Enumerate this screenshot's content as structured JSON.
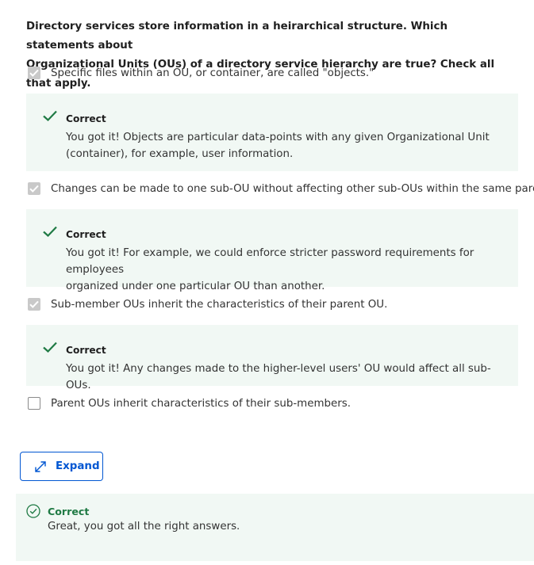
{
  "question": {
    "line1": "Directory services store information in a heirarchical structure. Which statements about",
    "line2": "Organizational Units (OUs) of a directory service hierarchy are true? Check all that apply."
  },
  "options": [
    {
      "label": "Specific files within an OU, or container, are called \"objects.\"",
      "checked": true,
      "feedback": {
        "title": "Correct",
        "line1": "You got it! Objects are particular data-points with any given Organizational Unit",
        "line2": "(container), for example, user information."
      }
    },
    {
      "label": "Changes can be made to one sub-OU without affecting other sub-OUs within the same parent.",
      "checked": true,
      "feedback": {
        "title": "Correct",
        "line1": "You got it! For example, we could enforce stricter password requirements for employees",
        "line2": "organized under one particular OU than another."
      }
    },
    {
      "label": "Sub-member OUs inherit the characteristics of their parent OU.",
      "checked": true,
      "feedback": {
        "title": "Correct",
        "line1": "You got it! Any changes made to the higher-level users' OU would affect all sub-OUs."
      }
    },
    {
      "label": "Parent OUs inherit characteristics of their sub-members.",
      "checked": false
    }
  ],
  "expand_button": {
    "label": "Expand",
    "icon": "expand-arrows-icon"
  },
  "result": {
    "title": "Correct",
    "message": "Great, you got all the right answers.",
    "icon": "check-circle-icon"
  },
  "colors": {
    "accent": "#0056d2",
    "correct_green": "#1f7a44",
    "feedback_bg": "#f1f8f4",
    "checkbox_checked": "#c9c9c9"
  }
}
